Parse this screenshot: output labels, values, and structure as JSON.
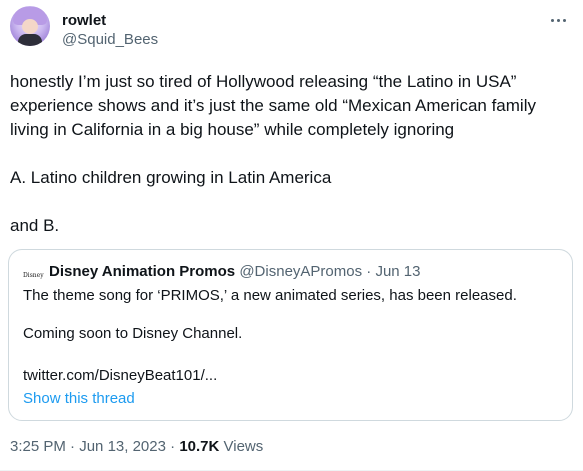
{
  "author": {
    "display_name": "rowlet",
    "handle": "@Squid_Bees"
  },
  "tweet": {
    "line1": "honestly I’m just so tired of Hollywood releasing “the Latino in USA”",
    "line2": "experience shows and it’s just the same old “Mexican American family",
    "line3": "living in California in a big house” while completely ignoring",
    "line4": "A. Latino children growing in Latin America",
    "line5": "and B."
  },
  "quote": {
    "avatar_text": "Disney",
    "name": "Disney Animation Promos",
    "handle": "@DisneyAPromos",
    "separator": "·",
    "date": "Jun 13",
    "line1": "The theme song for ‘PRIMOS,’ a new animated series, has been released.",
    "line2": "Coming soon to Disney Channel.",
    "line3": "twitter.com/DisneyBeat101/...",
    "show_thread": "Show this thread"
  },
  "footer": {
    "time": "3:25 PM",
    "separator": "·",
    "date": "Jun 13, 2023",
    "views_count": "10.7K",
    "views_label": "Views"
  },
  "icons": {
    "more": "more-horizontal-icon"
  }
}
